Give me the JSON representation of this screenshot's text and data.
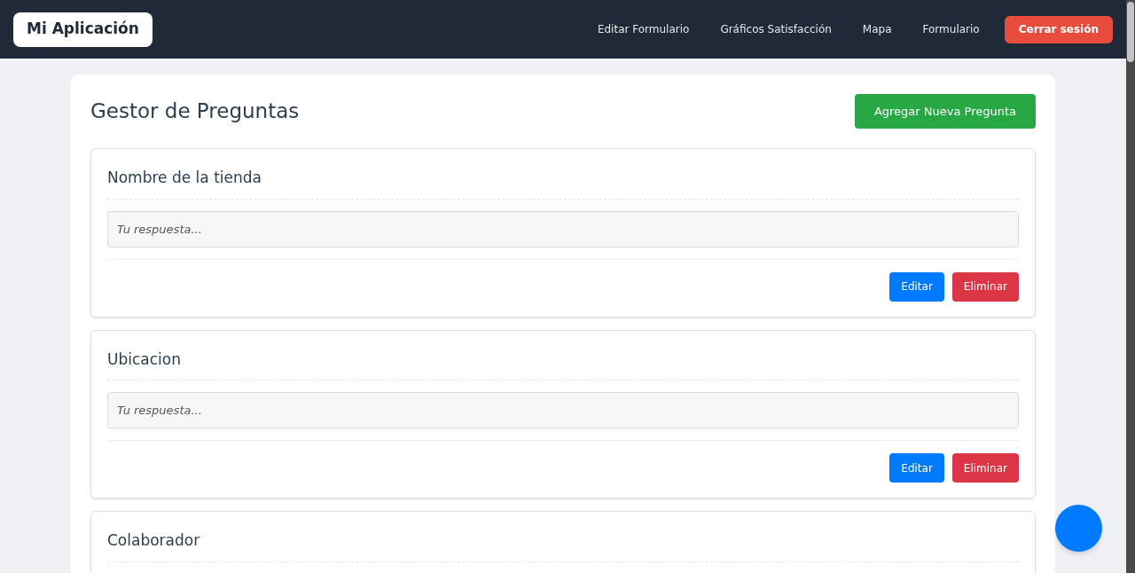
{
  "navbar": {
    "brand": "Mi Aplicación",
    "links": [
      "Editar Formulario",
      "Gráficos Satisfacción",
      "Mapa",
      "Formulario"
    ],
    "logout": "Cerrar sesión"
  },
  "page": {
    "title": "Gestor de Preguntas",
    "add_button": "Agregar Nueva Pregunta"
  },
  "questions": [
    {
      "title": "Nombre de la tienda",
      "placeholder": "Tu respuesta...",
      "edit": "Editar",
      "delete": "Eliminar"
    },
    {
      "title": "Ubicacion",
      "placeholder": "Tu respuesta...",
      "edit": "Editar",
      "delete": "Eliminar"
    },
    {
      "title": "Colaborador"
    }
  ]
}
